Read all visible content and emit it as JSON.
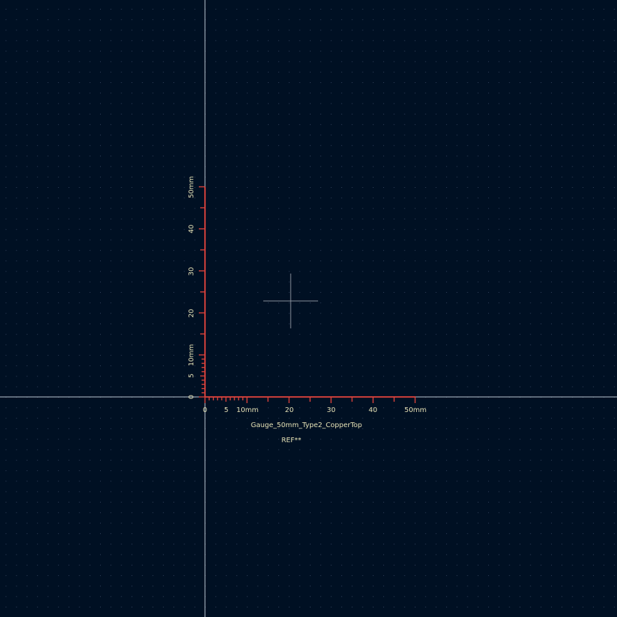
{
  "colors": {
    "background": "#001023",
    "grid_dot": "#3a4a66",
    "axis": "#c8d2dc",
    "gauge": "#d6413b",
    "text": "#e8e4b8",
    "crosshair": "#8f96a0"
  },
  "x_axis_labels": [
    "0",
    "5",
    "10mm",
    "20",
    "30",
    "40",
    "50mm"
  ],
  "y_axis_labels": [
    "0",
    "5",
    "10mm",
    "20",
    "30",
    "40",
    "50mm"
  ],
  "footprint": {
    "value_text": "Gauge_50mm_Type2_CopperTop",
    "reference_text": "REF**"
  }
}
